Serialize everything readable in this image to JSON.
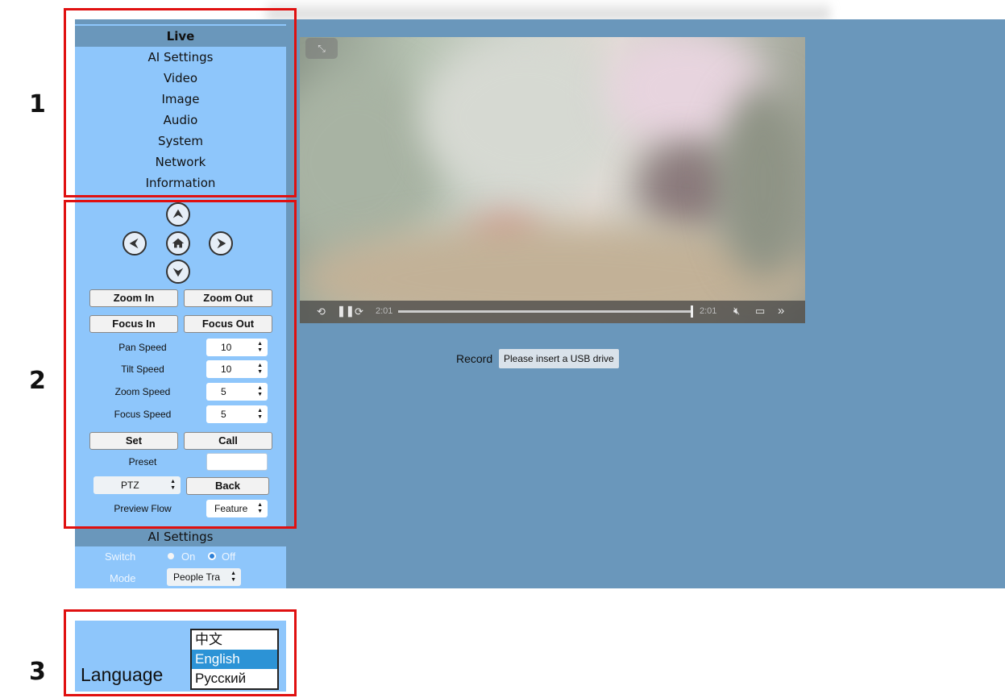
{
  "annotations": [
    "1",
    "2",
    "3"
  ],
  "nav": {
    "items": [
      {
        "label": "Live",
        "active": true
      },
      {
        "label": "AI Settings"
      },
      {
        "label": "Video"
      },
      {
        "label": "Image"
      },
      {
        "label": "Audio"
      },
      {
        "label": "System"
      },
      {
        "label": "Network"
      },
      {
        "label": "Information"
      }
    ]
  },
  "ptz": {
    "zoom_in": "Zoom In",
    "zoom_out": "Zoom Out",
    "focus_in": "Focus In",
    "focus_out": "Focus Out",
    "pan_speed_label": "Pan Speed",
    "pan_speed_value": "10",
    "tilt_speed_label": "Tilt Speed",
    "tilt_speed_value": "10",
    "zoom_speed_label": "Zoom Speed",
    "zoom_speed_value": "5",
    "focus_speed_label": "Focus Speed",
    "focus_speed_value": "5",
    "set": "Set",
    "call": "Call",
    "preset_label": "Preset",
    "preset_value": "",
    "mode_select": "PTZ",
    "back": "Back",
    "preview_flow_label": "Preview Flow",
    "preview_flow_value": "Feature"
  },
  "ai_settings": {
    "title": "AI Settings",
    "switch_label": "Switch",
    "on_label": "On",
    "off_label": "Off",
    "selected": "Off",
    "mode_label": "Mode",
    "mode_value": "People Tra"
  },
  "video": {
    "time_current": "2:01",
    "time_total": "2:01",
    "progress": 1.0
  },
  "record": {
    "label": "Record",
    "status": "Please insert a USB drive"
  },
  "language": {
    "label": "Language",
    "options": [
      "中文",
      "English",
      "Русский"
    ],
    "selected": "English"
  },
  "colors": {
    "sidebar_bg": "#8ec6fb",
    "main_bg": "#6a97bb",
    "annotation_box": "#e01010",
    "selected_option": "#2c93d6"
  }
}
